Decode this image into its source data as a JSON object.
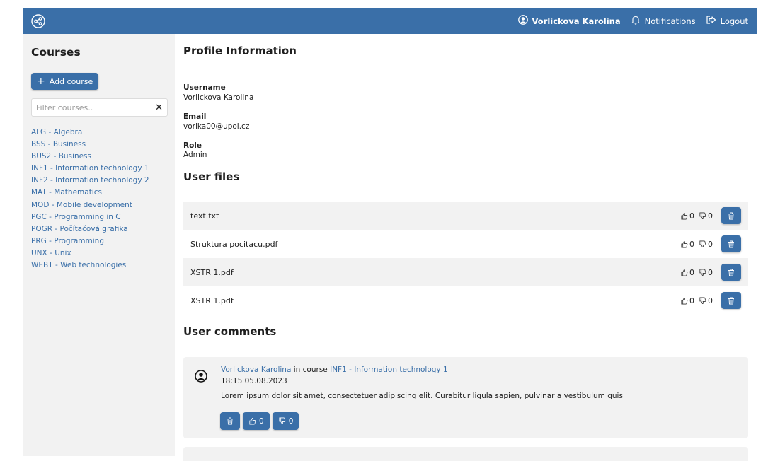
{
  "header": {
    "user_name": "Vorlickova Karolina",
    "notifications_label": "Notifications",
    "logout_label": "Logout"
  },
  "sidebar": {
    "title": "Courses",
    "add_course_label": "Add course",
    "filter_placeholder": "Filter courses..",
    "courses": [
      "ALG - Algebra",
      "BSS - Business",
      "BUS2 - Business",
      "INF1 - Information technology 1",
      "INF2 - Information technology 2",
      "MAT - Mathematics",
      "MOD - Mobile development",
      "PGC - Programming in C",
      "POGR - Počítačová grafika",
      "PRG - Programming",
      "UNX - Unix",
      "WEBT - Web technologies"
    ]
  },
  "profile": {
    "title": "Profile Information",
    "username_label": "Username",
    "username_value": "Vorlickova Karolina",
    "email_label": "Email",
    "email_value": "vorlka00@upol.cz",
    "role_label": "Role",
    "role_value": "Admin"
  },
  "files": {
    "title": "User files",
    "items": [
      {
        "name": "text.txt",
        "likes": "0",
        "dislikes": "0"
      },
      {
        "name": "Struktura pocitacu.pdf",
        "likes": "0",
        "dislikes": "0"
      },
      {
        "name": "XSTR 1.pdf",
        "likes": "0",
        "dislikes": "0"
      },
      {
        "name": "XSTR 1.pdf",
        "likes": "0",
        "dislikes": "0"
      }
    ]
  },
  "comments": {
    "title": "User comments",
    "items": [
      {
        "author": "Vorlickova Karolina",
        "in_course_text": " in course ",
        "course": "INF1 - Information technology 1",
        "time": "18:15 05.08.2023",
        "text": "Lorem ipsum dolor sit amet, consectetuer adipiscing elit. Curabitur ligula sapien, pulvinar a vestibulum quis",
        "likes": "0",
        "dislikes": "0"
      }
    ]
  },
  "colors": {
    "primary": "#3a6fa8",
    "sidebar_bg": "#f2f2f2",
    "row_alt_bg": "#f2f2f2"
  }
}
